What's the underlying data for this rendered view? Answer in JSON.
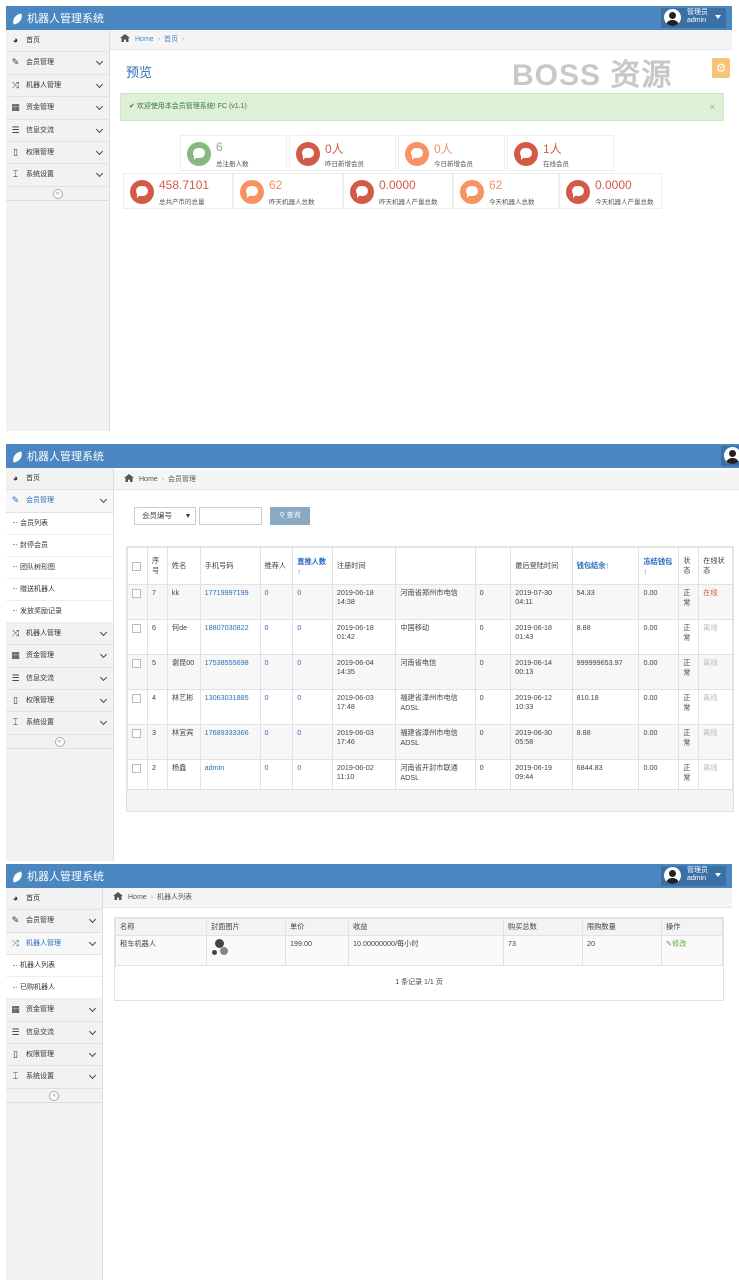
{
  "app": {
    "title": "机器人管理系统",
    "user_role": "管理员",
    "user_name": "admin"
  },
  "sidebar": {
    "items": [
      "首页",
      "会员管理",
      "机器人管理",
      "资金管理",
      "信息交流",
      "权限管理",
      "系统设置"
    ],
    "member_sub": [
      "会员列表",
      "封停会员",
      "团队树形图",
      "赠送机器人",
      "发放奖励记录"
    ],
    "robot_sub": [
      "机器人列表",
      "已购机器人"
    ],
    "collapse": "«"
  },
  "p1": {
    "bc_home": "Home",
    "bc_page": "首页",
    "title": "预览",
    "watermark": "BOSS 资源",
    "alert": "欢迎使用本会员管理系统! FC (v1.1)",
    "alert_close": "×",
    "stats": [
      {
        "num": "6",
        "label": "总注册人数",
        "color": "green"
      },
      {
        "num": "0人",
        "label": "昨日新增会员",
        "color": "red"
      },
      {
        "num": "0人",
        "label": "今日新增会员",
        "color": "orange"
      },
      {
        "num": "1人",
        "label": "在线会员",
        "color": "red"
      },
      {
        "num": "458.7101",
        "label": "总共产币的总量",
        "color": "red"
      },
      {
        "num": "62",
        "label": "昨天机器人总数",
        "color": "orange"
      },
      {
        "num": "0.0000",
        "label": "昨天机器人产量总数",
        "color": "red"
      },
      {
        "num": "62",
        "label": "今天机器人总数",
        "color": "orange"
      },
      {
        "num": "0.0000",
        "label": "今天机器人产量总数",
        "color": "red"
      }
    ]
  },
  "p2": {
    "bc_home": "Home",
    "bc_page": "会员管理",
    "search_field": "会员编号",
    "search_btn": "查询",
    "headers": [
      "序号",
      "姓名",
      "手机号码",
      "推荐人",
      "直推人数↑",
      "注册时间",
      "",
      "",
      "最后登陆时间",
      "钱包结余↑",
      "冻结钱包↑",
      "状态",
      "在线状态"
    ],
    "rows": [
      [
        "7",
        "kk",
        "17719997199",
        "0",
        "0",
        "2019-06-18 14:38",
        "河南省郑州市电信",
        "0",
        "2019-07-30 04:11",
        "54.33",
        "0.00",
        "正常",
        "在线"
      ],
      [
        "6",
        "何de",
        "18807030822",
        "0",
        "0",
        "2019-06-18 01:42",
        "中国移动",
        "0",
        "2019-06-18 01:43",
        "8.88",
        "0.00",
        "正常",
        "离线"
      ],
      [
        "5",
        "谢昆00",
        "17538555698",
        "0",
        "0",
        "2019-06-04 14:35",
        "河南省电信",
        "0",
        "2019-06-14 00:13",
        "999999653.97",
        "0.00",
        "正常",
        "离线"
      ],
      [
        "4",
        "林艺彬",
        "13063031885",
        "0",
        "0",
        "2019-06-03 17:48",
        "福建省漳州市电信ADSL",
        "0",
        "2019-06-12 10:33",
        "810.18",
        "0.00",
        "正常",
        "离线"
      ],
      [
        "3",
        "林宜宾",
        "17689333366",
        "0",
        "0",
        "2019-06-03 17:46",
        "福建省漳州市电信ADSL",
        "0",
        "2019-06-30 05:58",
        "8.88",
        "0.00",
        "正常",
        "离线"
      ],
      [
        "2",
        "杨鑫",
        "admin",
        "0",
        "0",
        "2019-06-02 11:10",
        "河南省开封市联通ADSL",
        "0",
        "2019-06-19 09:44",
        "6844.83",
        "0.00",
        "正常",
        "离线"
      ]
    ]
  },
  "p3": {
    "bc_home": "Home",
    "bc_page": "机器人列表",
    "headers": [
      "名称",
      "封面图片",
      "单价",
      "收益",
      "购买总数",
      "限购数量",
      "操作"
    ],
    "row": [
      "租车机器人",
      "",
      "199.00",
      "10.00000000/每小时",
      "73",
      "20",
      "修改"
    ],
    "pager": "1 条记录 1/1 页"
  }
}
